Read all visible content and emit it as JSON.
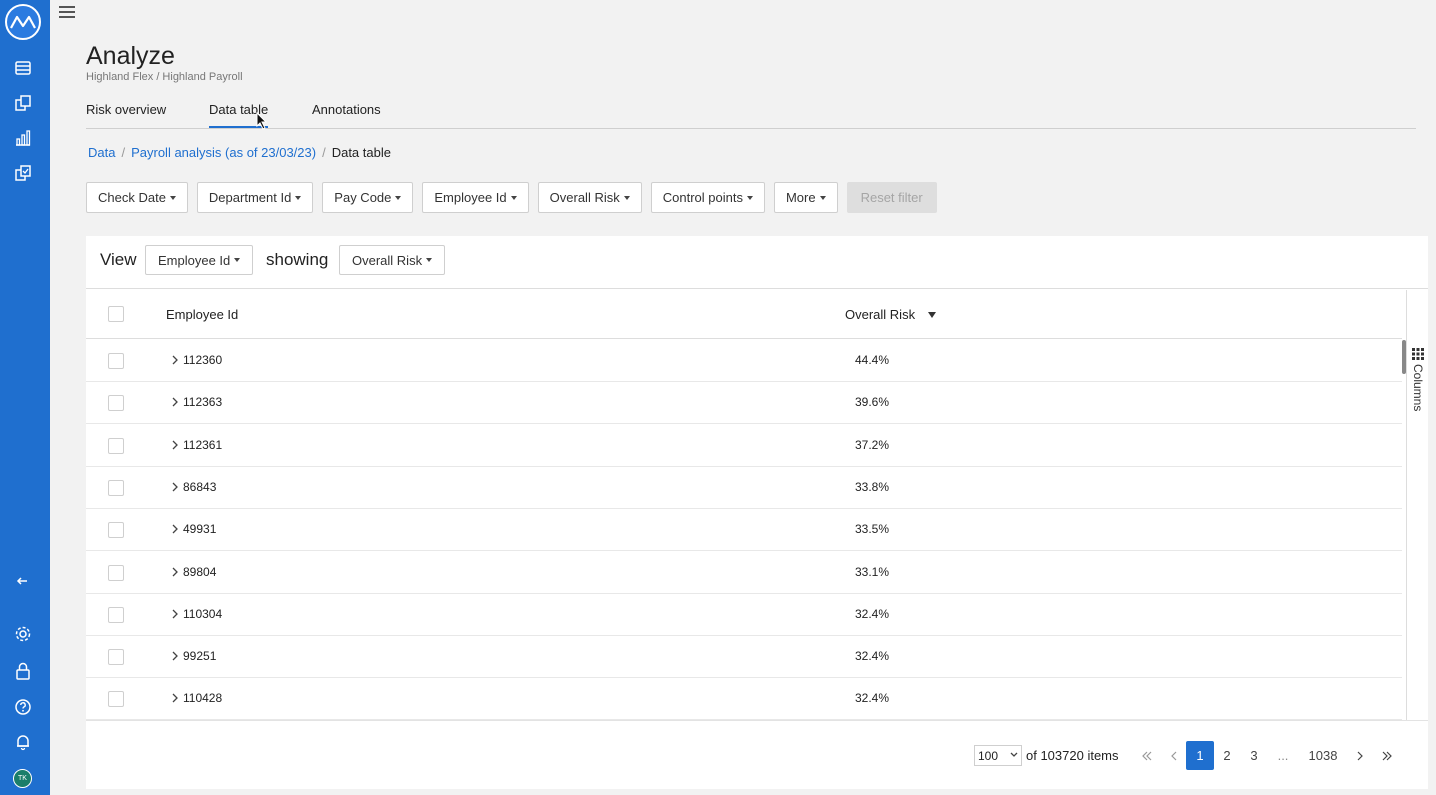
{
  "app": {
    "user_initials": "TK"
  },
  "header": {
    "title": "Analyze",
    "subtitle": "Highland Flex / Highland Payroll"
  },
  "tabs": [
    {
      "label": "Risk overview",
      "active": false
    },
    {
      "label": "Data table",
      "active": true
    },
    {
      "label": "Annotations",
      "active": false
    }
  ],
  "breadcrumb": [
    {
      "label": "Data"
    },
    {
      "label": "Payroll analysis (as of 23/03/23)"
    },
    {
      "label": "Data table"
    }
  ],
  "filters": {
    "check_date": "Check Date",
    "department_id": "Department Id",
    "pay_code": "Pay Code",
    "employee_id": "Employee Id",
    "overall_risk": "Overall Risk",
    "control_points": "Control points",
    "more": "More",
    "reset": "Reset filter"
  },
  "view_bar": {
    "view_label": "View",
    "view_value": "Employee Id",
    "showing_label": "showing",
    "showing_value": "Overall Risk"
  },
  "table": {
    "columns": [
      "Employee Id",
      "Overall Risk"
    ],
    "rows": [
      {
        "employee_id": "112360",
        "overall_risk": "44.4%"
      },
      {
        "employee_id": "112363",
        "overall_risk": "39.6%"
      },
      {
        "employee_id": "112361",
        "overall_risk": "37.2%"
      },
      {
        "employee_id": "86843",
        "overall_risk": "33.8%"
      },
      {
        "employee_id": "49931",
        "overall_risk": "33.5%"
      },
      {
        "employee_id": "89804",
        "overall_risk": "33.1%"
      },
      {
        "employee_id": "110304",
        "overall_risk": "32.4%"
      },
      {
        "employee_id": "99251",
        "overall_risk": "32.4%"
      },
      {
        "employee_id": "110428",
        "overall_risk": "32.4%"
      }
    ],
    "columns_panel_label": "Columns"
  },
  "pagination": {
    "page_size": "100",
    "total_text": "of 103720 items",
    "pages": [
      "1",
      "2",
      "3",
      "...",
      "1038"
    ],
    "current_page": "1"
  },
  "colors": {
    "accent": "#1f6fcf",
    "sidebar": "#1f6fcf"
  }
}
